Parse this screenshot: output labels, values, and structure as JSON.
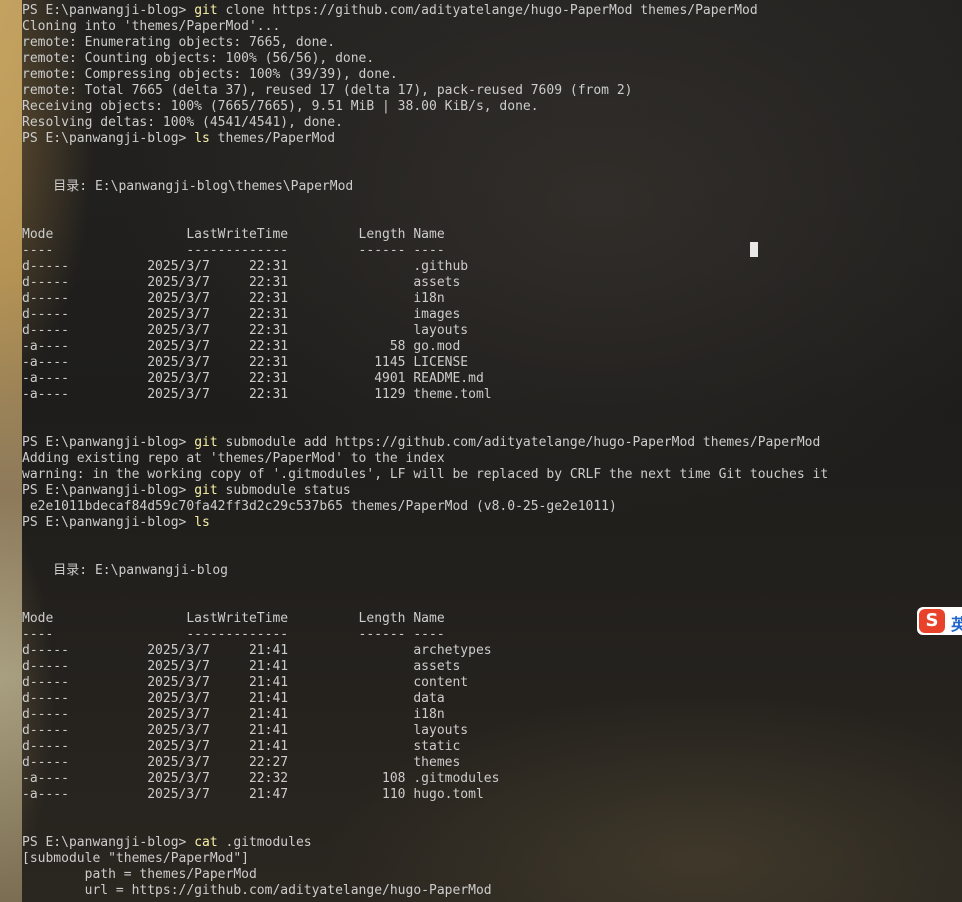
{
  "lines": [
    {
      "prompt": "PS E:\\panwangji-blog> ",
      "cmd": "git",
      "rest": " clone https://github.com/adityatelange/hugo-PaperMod themes/PaperMod"
    },
    {
      "text": "Cloning into 'themes/PaperMod'..."
    },
    {
      "text": "remote: Enumerating objects: 7665, done."
    },
    {
      "text": "remote: Counting objects: 100% (56/56), done."
    },
    {
      "text": "remote: Compressing objects: 100% (39/39), done."
    },
    {
      "text": "remote: Total 7665 (delta 37), reused 17 (delta 17), pack-reused 7609 (from 2)"
    },
    {
      "text": "Receiving objects: 100% (7665/7665), 9.51 MiB | 38.00 KiB/s, done."
    },
    {
      "text": "Resolving deltas: 100% (4541/4541), done."
    },
    {
      "prompt": "PS E:\\panwangji-blog> ",
      "cmd": "ls",
      "rest": " themes/PaperMod"
    },
    {
      "text": ""
    },
    {
      "text": ""
    },
    {
      "text": "    目录: E:\\panwangji-blog\\themes\\PaperMod"
    },
    {
      "text": ""
    },
    {
      "text": ""
    },
    {
      "text": "Mode                 LastWriteTime         Length Name"
    },
    {
      "text": "----                 -------------         ------ ----"
    },
    {
      "text": "d-----          2025/3/7     22:31                .github"
    },
    {
      "text": "d-----          2025/3/7     22:31                assets"
    },
    {
      "text": "d-----          2025/3/7     22:31                i18n"
    },
    {
      "text": "d-----          2025/3/7     22:31                images"
    },
    {
      "text": "d-----          2025/3/7     22:31                layouts"
    },
    {
      "text": "-a----          2025/3/7     22:31             58 go.mod"
    },
    {
      "text": "-a----          2025/3/7     22:31           1145 LICENSE"
    },
    {
      "text": "-a----          2025/3/7     22:31           4901 README.md"
    },
    {
      "text": "-a----          2025/3/7     22:31           1129 theme.toml"
    },
    {
      "text": ""
    },
    {
      "text": ""
    },
    {
      "prompt": "PS E:\\panwangji-blog> ",
      "cmd": "git",
      "rest": " submodule add https://github.com/adityatelange/hugo-PaperMod themes/PaperMod"
    },
    {
      "text": "Adding existing repo at 'themes/PaperMod' to the index"
    },
    {
      "text": "warning: in the working copy of '.gitmodules', LF will be replaced by CRLF the next time Git touches it"
    },
    {
      "prompt": "PS E:\\panwangji-blog> ",
      "cmd": "git",
      "rest": " submodule status"
    },
    {
      "text": " e2e1011bdecaf84d59c70fa42ff3d2c29c537b65 themes/PaperMod (v8.0-25-ge2e1011)"
    },
    {
      "prompt": "PS E:\\panwangji-blog> ",
      "cmd": "ls",
      "rest": ""
    },
    {
      "text": ""
    },
    {
      "text": ""
    },
    {
      "text": "    目录: E:\\panwangji-blog"
    },
    {
      "text": ""
    },
    {
      "text": ""
    },
    {
      "text": "Mode                 LastWriteTime         Length Name"
    },
    {
      "text": "----                 -------------         ------ ----"
    },
    {
      "text": "d-----          2025/3/7     21:41                archetypes"
    },
    {
      "text": "d-----          2025/3/7     21:41                assets"
    },
    {
      "text": "d-----          2025/3/7     21:41                content"
    },
    {
      "text": "d-----          2025/3/7     21:41                data"
    },
    {
      "text": "d-----          2025/3/7     21:41                i18n"
    },
    {
      "text": "d-----          2025/3/7     21:41                layouts"
    },
    {
      "text": "d-----          2025/3/7     21:41                static"
    },
    {
      "text": "d-----          2025/3/7     22:27                themes"
    },
    {
      "text": "-a----          2025/3/7     22:32            108 .gitmodules"
    },
    {
      "text": "-a----          2025/3/7     21:47            110 hugo.toml"
    },
    {
      "text": ""
    },
    {
      "text": ""
    },
    {
      "prompt": "PS E:\\panwangji-blog> ",
      "cmd": "cat",
      "rest": " .gitmodules"
    },
    {
      "text": "[submodule \"themes/PaperMod\"]"
    },
    {
      "text": "        path = themes/PaperMod"
    },
    {
      "text": "        url = https://github.com/adityatelange/hugo-PaperMod"
    }
  ],
  "ime": {
    "badge": "S",
    "mode": "英",
    "brand_color": "#e8432a"
  },
  "colors": {
    "text": "#cccccc",
    "command": "#f9f1a5"
  }
}
